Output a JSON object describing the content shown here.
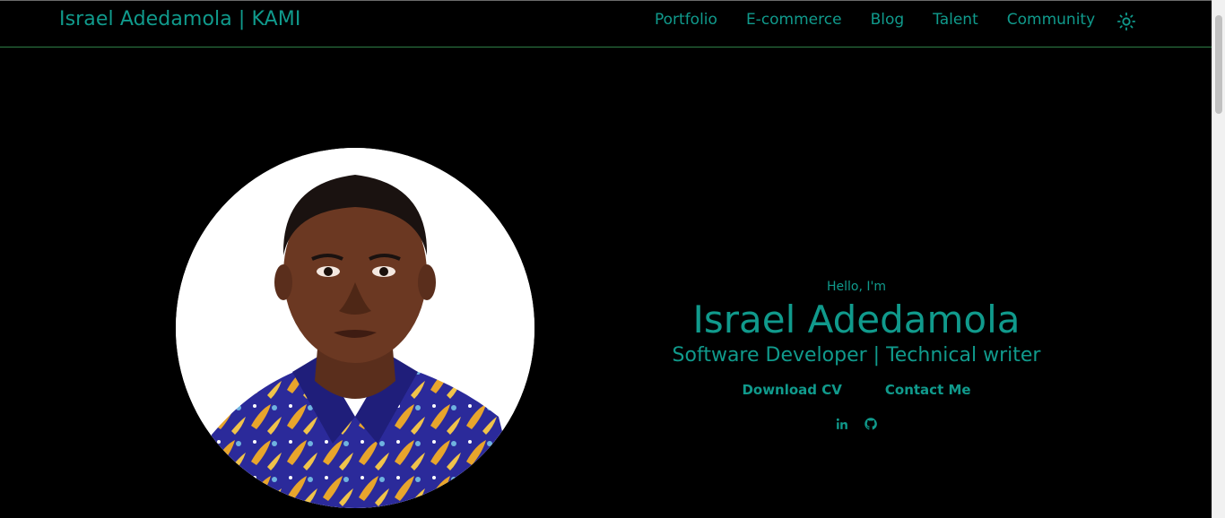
{
  "header": {
    "brand": "Israel Adedamola | KAMI",
    "nav": [
      "Portfolio",
      "E-commerce",
      "Blog",
      "Talent",
      "Community"
    ],
    "theme_toggle_icon": "sun-icon"
  },
  "hero": {
    "greeting": "Hello, I'm",
    "name": "Israel Adedamola",
    "role": "Software Developer | Technical writer",
    "buttons": {
      "download_cv": "Download CV",
      "contact": "Contact Me"
    },
    "socials": [
      "linkedin-icon",
      "github-icon"
    ],
    "portrait": "profile-photo"
  },
  "colors": {
    "accent": "#109a8c",
    "background": "#000000",
    "nav_border": "#2e7d46"
  }
}
